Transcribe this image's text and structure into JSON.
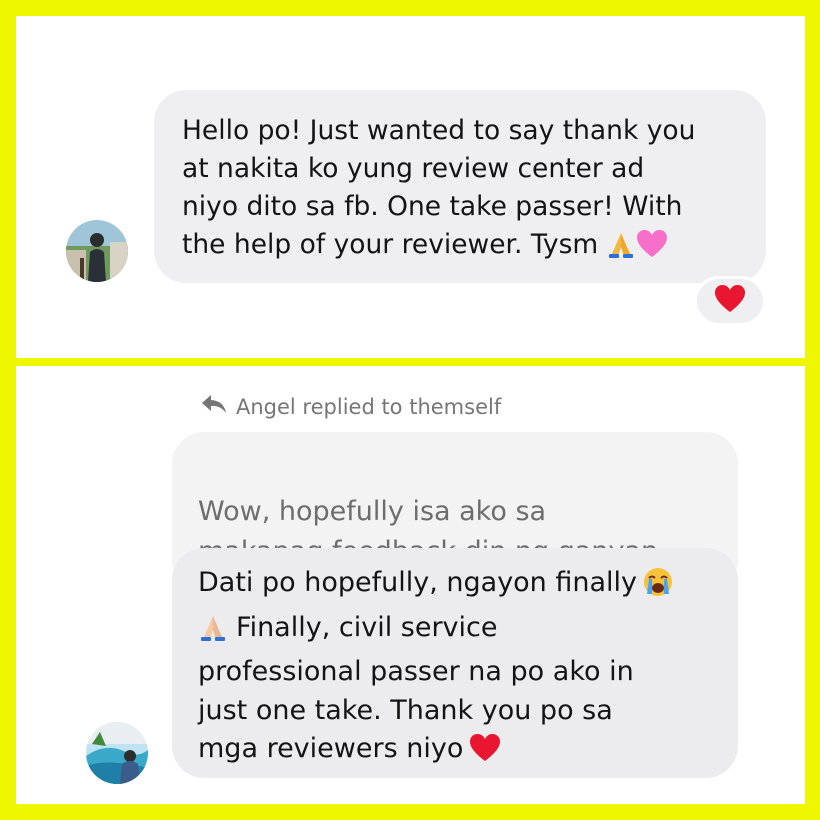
{
  "top_panel": {
    "message": "Hello po! Just wanted to say thank you\nat nakita ko yung review center ad\nniyo dito sa fb. One take passer! With\nthe help of your reviewer. Tysm",
    "message_emojis": [
      "folded-hands",
      "pink-heart"
    ],
    "reaction": "red-heart"
  },
  "bottom_panel": {
    "reply_label": "Angel replied to themself",
    "quoted_message": "Wow, hopefully isa ako sa\nmakapag feedback din ng ganyan",
    "message_line1": "Dati po hopefully, ngayon finally",
    "message_line2": "Finally, civil service\nprofessional passer na po ako in\njust one take. Thank you po sa\nmga reviewers niyo",
    "message_emojis": [
      "crying-face",
      "folded-hands",
      "red-heart"
    ]
  },
  "colors": {
    "frame": "#eef700",
    "bubble": "#efeff1",
    "heart": "#e8162e",
    "pink_heart": "#f66fc8"
  }
}
